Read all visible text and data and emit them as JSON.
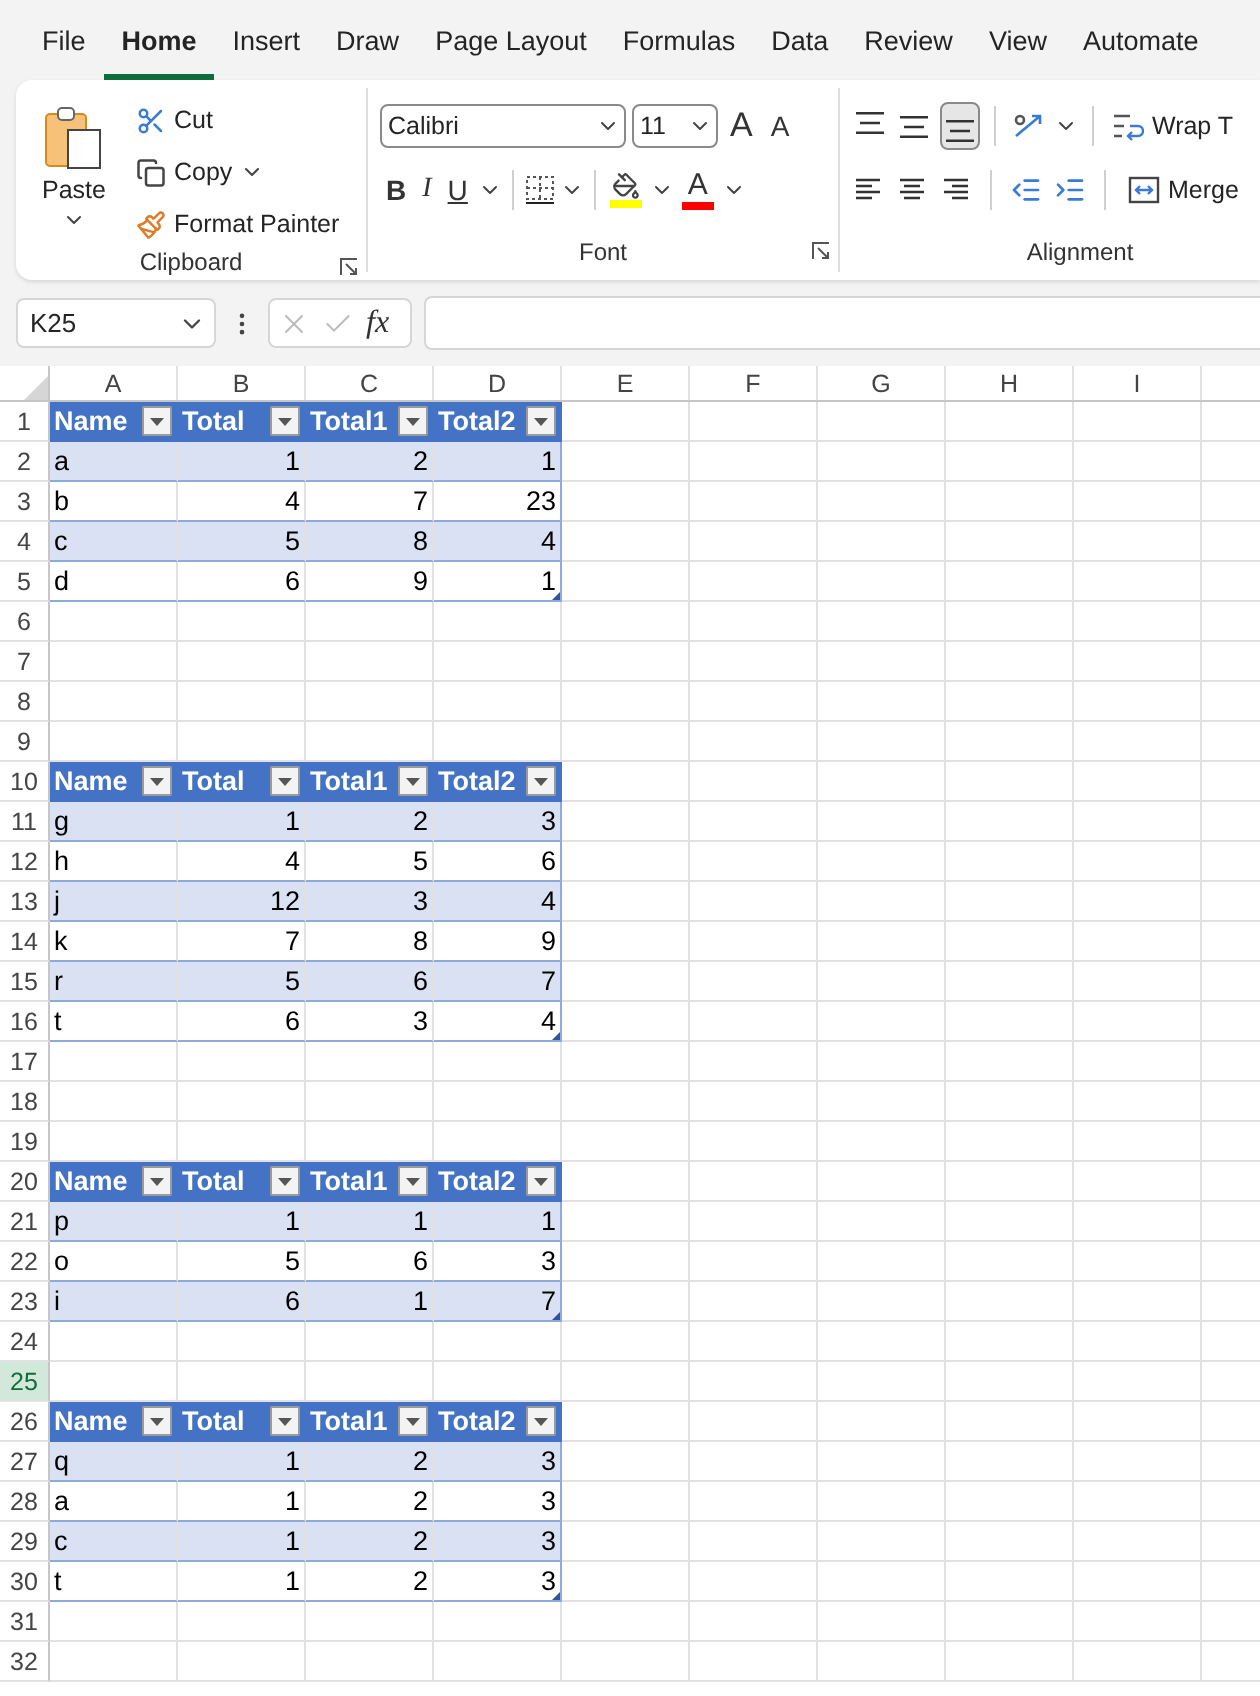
{
  "menu_tabs": [
    {
      "label": "File",
      "selected": false
    },
    {
      "label": "Home",
      "selected": true
    },
    {
      "label": "Insert",
      "selected": false
    },
    {
      "label": "Draw",
      "selected": false
    },
    {
      "label": "Page Layout",
      "selected": false
    },
    {
      "label": "Formulas",
      "selected": false
    },
    {
      "label": "Data",
      "selected": false
    },
    {
      "label": "Review",
      "selected": false
    },
    {
      "label": "View",
      "selected": false
    },
    {
      "label": "Automate",
      "selected": false
    }
  ],
  "ribbon": {
    "clipboard": {
      "paste": "Paste",
      "cut": "Cut",
      "copy": "Copy",
      "format_painter": "Format Painter",
      "label": "Clipboard"
    },
    "font": {
      "name": "Calibri",
      "size": "11",
      "grow": "A",
      "shrink": "A",
      "bold": "B",
      "italic": "I",
      "underline": "U",
      "font_color": "A",
      "label": "Font"
    },
    "alignment": {
      "vertical": [
        {
          "kind": "top",
          "selected": false
        },
        {
          "kind": "middle",
          "selected": false
        },
        {
          "kind": "bottom",
          "selected": true
        }
      ],
      "wrap": "Wrap T",
      "merge": "Merge",
      "label": "Alignment"
    }
  },
  "formula_bar": {
    "name_box": "K25",
    "fx": "fx"
  },
  "sheet": {
    "columns": [
      "A",
      "B",
      "C",
      "D",
      "E",
      "F",
      "G",
      "H",
      "I"
    ],
    "rows": [
      {
        "number": "1",
        "kind": "header",
        "selected": false,
        "table_end": false,
        "cells": [
          "Name",
          "Total",
          "Total1",
          "Total2"
        ]
      },
      {
        "number": "2",
        "kind": "band",
        "selected": false,
        "table_end": false,
        "cells": [
          "a",
          "1",
          "2",
          "1"
        ]
      },
      {
        "number": "3",
        "kind": "plain",
        "selected": false,
        "table_end": false,
        "cells": [
          "b",
          "4",
          "7",
          "23"
        ]
      },
      {
        "number": "4",
        "kind": "band",
        "selected": false,
        "table_end": false,
        "cells": [
          "c",
          "5",
          "8",
          "4"
        ]
      },
      {
        "number": "5",
        "kind": "plain",
        "selected": false,
        "table_end": true,
        "cells": [
          "d",
          "6",
          "9",
          "1"
        ]
      },
      {
        "number": "6",
        "kind": "empty",
        "selected": false
      },
      {
        "number": "7",
        "kind": "empty",
        "selected": false
      },
      {
        "number": "8",
        "kind": "empty",
        "selected": false
      },
      {
        "number": "9",
        "kind": "empty",
        "selected": false
      },
      {
        "number": "10",
        "kind": "header",
        "selected": false,
        "table_end": false,
        "cells": [
          "Name",
          "Total",
          "Total1",
          "Total2"
        ]
      },
      {
        "number": "11",
        "kind": "band",
        "selected": false,
        "table_end": false,
        "cells": [
          "g",
          "1",
          "2",
          "3"
        ]
      },
      {
        "number": "12",
        "kind": "plain",
        "selected": false,
        "table_end": false,
        "cells": [
          "h",
          "4",
          "5",
          "6"
        ]
      },
      {
        "number": "13",
        "kind": "band",
        "selected": false,
        "table_end": false,
        "cells": [
          "j",
          "12",
          "3",
          "4"
        ]
      },
      {
        "number": "14",
        "kind": "plain",
        "selected": false,
        "table_end": false,
        "cells": [
          "k",
          "7",
          "8",
          "9"
        ]
      },
      {
        "number": "15",
        "kind": "band",
        "selected": false,
        "table_end": false,
        "cells": [
          "r",
          "5",
          "6",
          "7"
        ]
      },
      {
        "number": "16",
        "kind": "plain",
        "selected": false,
        "table_end": true,
        "cells": [
          "t",
          "6",
          "3",
          "4"
        ]
      },
      {
        "number": "17",
        "kind": "empty",
        "selected": false
      },
      {
        "number": "18",
        "kind": "empty",
        "selected": false
      },
      {
        "number": "19",
        "kind": "empty",
        "selected": false
      },
      {
        "number": "20",
        "kind": "header",
        "selected": false,
        "table_end": false,
        "cells": [
          "Name",
          "Total",
          "Total1",
          "Total2"
        ]
      },
      {
        "number": "21",
        "kind": "band",
        "selected": false,
        "table_end": false,
        "cells": [
          "p",
          "1",
          "1",
          "1"
        ]
      },
      {
        "number": "22",
        "kind": "plain",
        "selected": false,
        "table_end": false,
        "cells": [
          "o",
          "5",
          "6",
          "3"
        ]
      },
      {
        "number": "23",
        "kind": "band",
        "selected": false,
        "table_end": true,
        "cells": [
          "i",
          "6",
          "1",
          "7"
        ]
      },
      {
        "number": "24",
        "kind": "empty",
        "selected": false
      },
      {
        "number": "25",
        "kind": "empty",
        "selected": true
      },
      {
        "number": "26",
        "kind": "header",
        "selected": false,
        "table_end": false,
        "cells": [
          "Name",
          "Total",
          "Total1",
          "Total2"
        ]
      },
      {
        "number": "27",
        "kind": "band",
        "selected": false,
        "table_end": false,
        "cells": [
          "q",
          "1",
          "2",
          "3"
        ]
      },
      {
        "number": "28",
        "kind": "plain",
        "selected": false,
        "table_end": false,
        "cells": [
          "a",
          "1",
          "2",
          "3"
        ]
      },
      {
        "number": "29",
        "kind": "band",
        "selected": false,
        "table_end": false,
        "cells": [
          "c",
          "1",
          "2",
          "3"
        ]
      },
      {
        "number": "30",
        "kind": "plain",
        "selected": false,
        "table_end": true,
        "cells": [
          "t",
          "1",
          "2",
          "3"
        ]
      },
      {
        "number": "31",
        "kind": "empty",
        "selected": false
      },
      {
        "number": "32",
        "kind": "empty",
        "selected": false
      }
    ]
  }
}
